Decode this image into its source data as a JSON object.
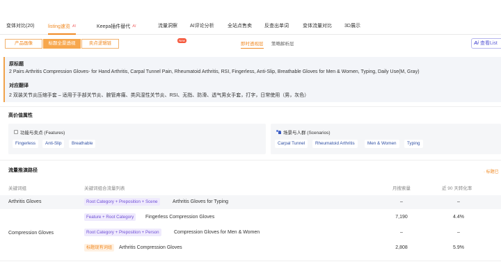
{
  "nav": {
    "items": [
      {
        "label": "变体对比(20)"
      },
      {
        "label": "listing速览",
        "ai": "AI"
      },
      {
        "label": "Keepa插件替代",
        "ai": "AI"
      },
      {
        "label": "流量洞察",
        "badge": "New"
      },
      {
        "label": "AI评论分析"
      },
      {
        "label": "全站点售卖"
      },
      {
        "label": "反查出单词"
      },
      {
        "label": "变体流量对比"
      },
      {
        "label": "3D展示"
      }
    ]
  },
  "subbar": {
    "segments": [
      "产品画像",
      "标题全景透视",
      "卖点逻辑链"
    ],
    "views": [
      "即时透视层",
      "策略解析层"
    ],
    "ai_button": {
      "prefix": "Ai",
      "label": "查看List"
    }
  },
  "title_section": {
    "original_heading": "原标题",
    "original_text": "2 Pairs Arthritis Compression Gloves- for Hand Arthritis, Carpal Tunnel Pain, Rheumatoid Arthritis, RSI, Fingerless, Anti-Slip, Breathable Gloves for Men & Women, Typing, Daily Use(M, Gray)",
    "translation_heading": "对应翻译",
    "translation_text": "2 双装关节炎压缩手套 – 适用于手部关节炎、腕管疼痛、类风湿性关节炎、RSI、无指、防滑、透气男女手套，打字，日常使用（男，灰色）"
  },
  "attributes": {
    "heading": "高价值属性",
    "features": {
      "title": "功能与卖点 (Features)",
      "tags": [
        "Fingerless",
        "Anti-Slip",
        "Breathable"
      ]
    },
    "scenarios": {
      "title": "场景与人群 (Scenarios)",
      "tags": [
        "Carpal Tunnel",
        "Rheumatoid Arthritis",
        "Men & Women",
        "Typing"
      ]
    }
  },
  "traffic": {
    "heading": "流量推演路径",
    "right_note": "标题已",
    "columns": [
      "关键词组",
      "关键词组合流量列表",
      "月搜索量",
      "近 90 天转化率"
    ],
    "rows": [
      {
        "group": "Arthritis Gloves",
        "pill": "Root Category + Preposition + Scene",
        "pill_color": "purple",
        "keyword": "Arthritis Gloves for Typing",
        "volume": "–",
        "rate": "–"
      },
      {
        "group": "",
        "pill": "Feature + Root Category",
        "pill_color": "purple",
        "keyword": "Fingerless Compression Gloves",
        "volume": "7,190",
        "rate": "4.4%"
      },
      {
        "group": "Compression Gloves",
        "pill": "Root Category + Preposition + Person",
        "pill_color": "purple",
        "keyword": "Compression Gloves for Men & Women",
        "volume": "–",
        "rate": "–"
      },
      {
        "group": "",
        "pill": "标题现有词组",
        "pill_color": "orange",
        "keyword": "Arthritis Compression Gloves",
        "volume": "2,808",
        "rate": "5.9%"
      }
    ]
  },
  "colors": {
    "accent": "#f08a24",
    "tag_text": "#2f4fa3",
    "pill_purple": "#6f4fd6"
  }
}
